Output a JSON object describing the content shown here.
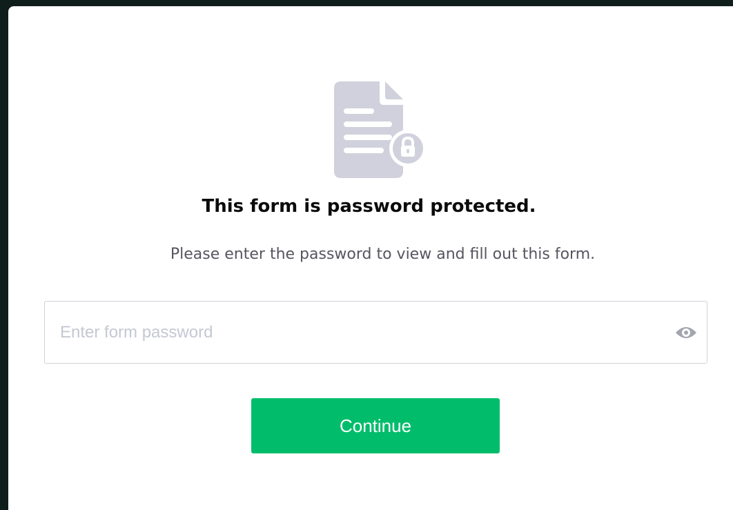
{
  "modal": {
    "icon": "document-lock-icon",
    "title": "This form is password protected.",
    "subtitle": "Please enter the password to view and fill out this form.",
    "password_input": {
      "value": "",
      "placeholder": "Enter form password",
      "toggle_icon": "eye-icon"
    },
    "continue_label": "Continue"
  },
  "colors": {
    "background": "#0f1d1b",
    "card": "#ffffff",
    "icon_fill": "#d0d1dc",
    "button": "#01bd6b",
    "placeholder": "#c4c8d4",
    "eye_icon": "#a3a6ae"
  }
}
